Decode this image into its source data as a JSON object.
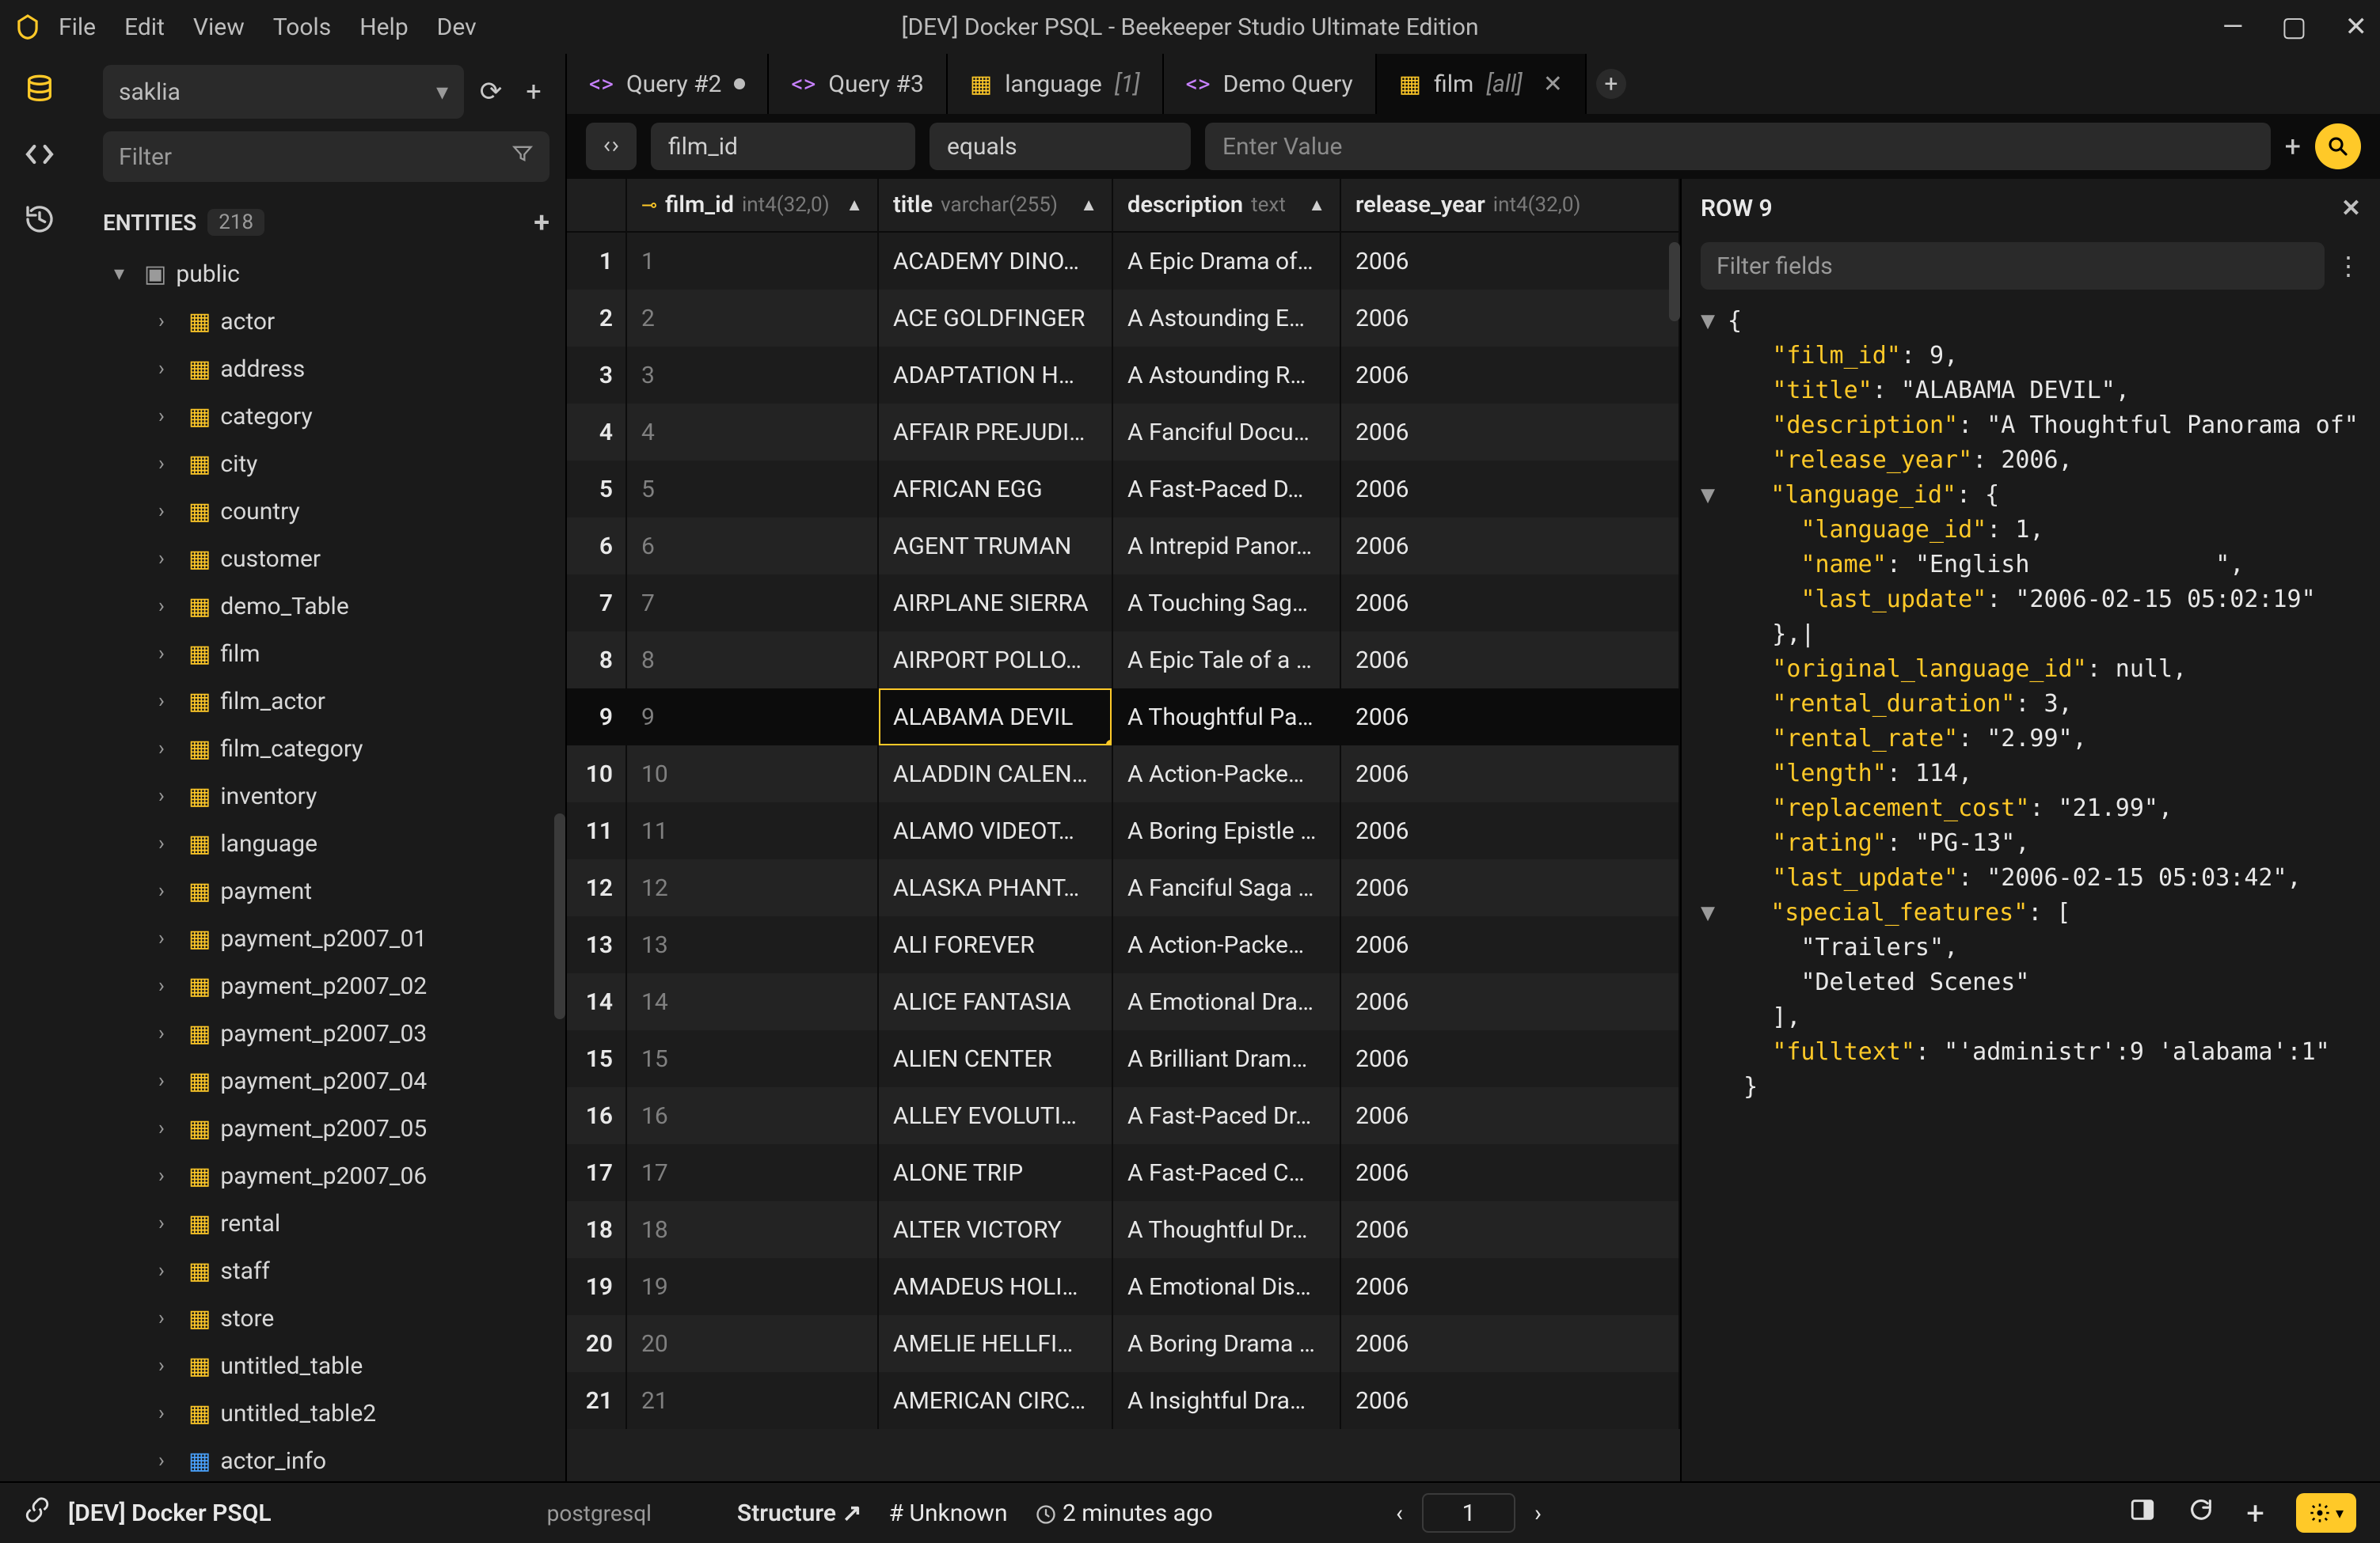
{
  "title": "[DEV] Docker PSQL - Beekeeper Studio Ultimate Edition",
  "menu": [
    "File",
    "Edit",
    "View",
    "Tools",
    "Help",
    "Dev"
  ],
  "sidebar": {
    "db": "saklia",
    "filter_placeholder": "Filter",
    "entities_label": "ENTITIES",
    "entities_count": "218",
    "schema": "public",
    "tables": [
      "actor",
      "address",
      "category",
      "city",
      "country",
      "customer",
      "demo_Table",
      "film",
      "film_actor",
      "film_category",
      "inventory",
      "language",
      "payment",
      "payment_p2007_01",
      "payment_p2007_02",
      "payment_p2007_03",
      "payment_p2007_04",
      "payment_p2007_05",
      "payment_p2007_06",
      "rental",
      "staff",
      "store",
      "untitled_table",
      "untitled_table2",
      "actor_info"
    ]
  },
  "tabs": [
    {
      "icon": "query",
      "label": "Query #2",
      "suffix": "",
      "dirty": true,
      "close": false
    },
    {
      "icon": "query",
      "label": "Query #3",
      "suffix": "",
      "dirty": false,
      "close": false
    },
    {
      "icon": "table",
      "label": "language",
      "suffix": "[1]",
      "dirty": false,
      "close": false
    },
    {
      "icon": "query",
      "label": "Demo Query",
      "suffix": "",
      "dirty": false,
      "close": false
    },
    {
      "icon": "table",
      "label": "film",
      "suffix": "[all]",
      "dirty": false,
      "close": true,
      "active": true
    }
  ],
  "filter": {
    "column": "film_id",
    "op": "equals",
    "value_placeholder": "Enter Value"
  },
  "columns": [
    {
      "name": "film_id",
      "type": "int4(32,0)",
      "key": true,
      "sort": "▲"
    },
    {
      "name": "title",
      "type": "varchar(255)",
      "key": false,
      "sort": "▲"
    },
    {
      "name": "description",
      "type": "text",
      "key": false,
      "sort": "▲"
    },
    {
      "name": "release_year",
      "type": "int4(32,0)",
      "key": false,
      "sort": ""
    }
  ],
  "rows": [
    {
      "id": "1",
      "title": "ACADEMY DINO…",
      "desc": "A Epic Drama of…",
      "year": "2006"
    },
    {
      "id": "2",
      "title": "ACE GOLDFINGER",
      "desc": "A Astounding E…",
      "year": "2006"
    },
    {
      "id": "3",
      "title": "ADAPTATION H…",
      "desc": "A Astounding R…",
      "year": "2006"
    },
    {
      "id": "4",
      "title": "AFFAIR PREJUDI…",
      "desc": "A Fanciful Docu…",
      "year": "2006"
    },
    {
      "id": "5",
      "title": "AFRICAN EGG",
      "desc": "A Fast-Paced D…",
      "year": "2006"
    },
    {
      "id": "6",
      "title": "AGENT TRUMAN",
      "desc": "A Intrepid Panor…",
      "year": "2006"
    },
    {
      "id": "7",
      "title": "AIRPLANE SIERRA",
      "desc": "A Touching Sag…",
      "year": "2006"
    },
    {
      "id": "8",
      "title": "AIRPORT POLLO…",
      "desc": "A Epic Tale of a …",
      "year": "2006"
    },
    {
      "id": "9",
      "title": "ALABAMA DEVIL",
      "desc": "A Thoughtful Pa…",
      "year": "2006",
      "selected": true
    },
    {
      "id": "10",
      "title": "ALADDIN CALEN…",
      "desc": "A Action-Packe…",
      "year": "2006"
    },
    {
      "id": "11",
      "title": "ALAMO VIDEOT…",
      "desc": "A Boring Epistle …",
      "year": "2006"
    },
    {
      "id": "12",
      "title": "ALASKA PHANT…",
      "desc": "A Fanciful Saga …",
      "year": "2006"
    },
    {
      "id": "13",
      "title": "ALI FOREVER",
      "desc": "A Action-Packe…",
      "year": "2006"
    },
    {
      "id": "14",
      "title": "ALICE FANTASIA",
      "desc": "A Emotional Dra…",
      "year": "2006"
    },
    {
      "id": "15",
      "title": "ALIEN CENTER",
      "desc": "A Brilliant Dram…",
      "year": "2006"
    },
    {
      "id": "16",
      "title": "ALLEY EVOLUTI…",
      "desc": "A Fast-Paced Dr…",
      "year": "2006"
    },
    {
      "id": "17",
      "title": "ALONE TRIP",
      "desc": "A Fast-Paced C…",
      "year": "2006"
    },
    {
      "id": "18",
      "title": "ALTER VICTORY",
      "desc": "A Thoughtful Dr…",
      "year": "2006"
    },
    {
      "id": "19",
      "title": "AMADEUS HOLI…",
      "desc": "A Emotional Dis…",
      "year": "2006"
    },
    {
      "id": "20",
      "title": "AMELIE HELLFI…",
      "desc": "A Boring Drama …",
      "year": "2006"
    },
    {
      "id": "21",
      "title": "AMERICAN CIRC…",
      "desc": "A Insightful Dra…",
      "year": "2006"
    }
  ],
  "detail": {
    "header": "ROW 9",
    "filter_placeholder": "Filter fields",
    "row": {
      "film_id": 9,
      "title": "ALABAMA DEVIL",
      "description": "A Thoughtful Panorama of",
      "release_year": 2006,
      "language_id": {
        "language_id": 1,
        "name": "English             ",
        "last_update": "2006-02-15 05:02:19"
      },
      "original_language_id": null,
      "rental_duration": 3,
      "rental_rate": "2.99",
      "length": 114,
      "replacement_cost": "21.99",
      "rating": "PG-13",
      "last_update": "2006-02-15 05:03:42",
      "special_features": [
        "Trailers",
        "Deleted Scenes"
      ],
      "fulltext": "'administr':9 'alabama':1"
    }
  },
  "status": {
    "conn_name": "[DEV] Docker PSQL",
    "conn_type": "postgresql",
    "structure": "Structure",
    "rowcount": "Unknown",
    "time": "2 minutes ago",
    "page": "1"
  }
}
